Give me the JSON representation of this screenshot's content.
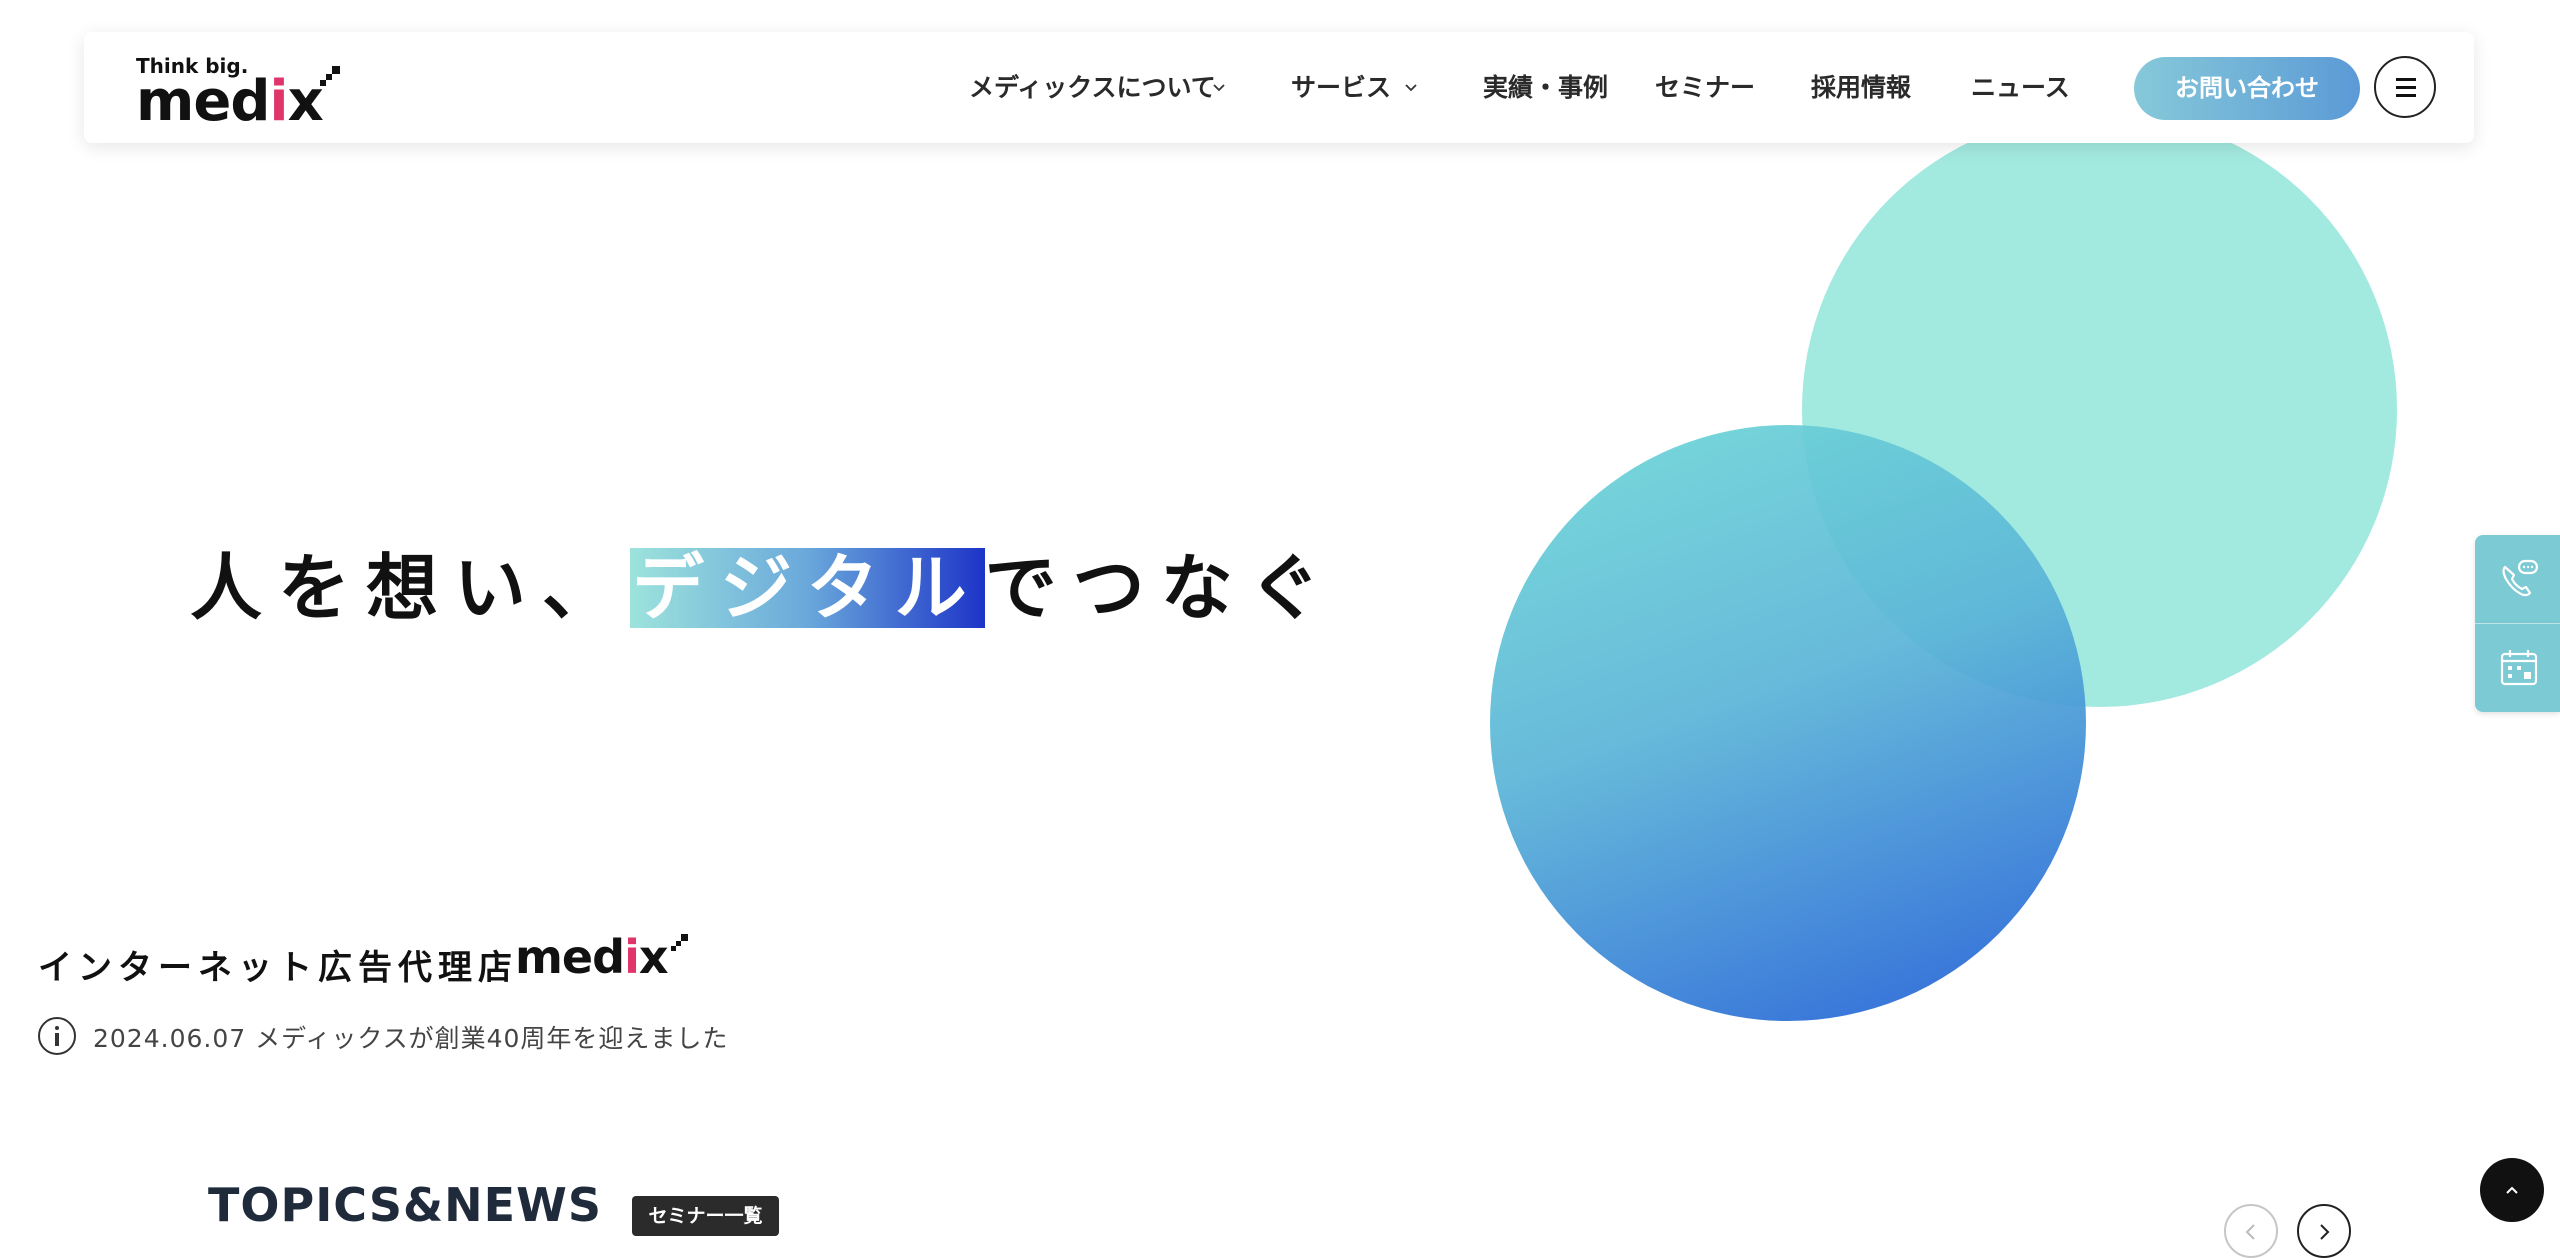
{
  "header": {
    "logo_tagline": "Think big.",
    "logo_name_start": "med",
    "logo_name_i": "i",
    "logo_name_end": "x",
    "nav": [
      {
        "label": "メディックスについて",
        "has_dropdown": true
      },
      {
        "label": "サービス",
        "has_dropdown": true
      },
      {
        "label": "実績・事例",
        "has_dropdown": false
      },
      {
        "label": "セミナー",
        "has_dropdown": false
      },
      {
        "label": "採用情報",
        "has_dropdown": false
      },
      {
        "label": "ニュース",
        "has_dropdown": false
      }
    ],
    "contact_label": "お問い合わせ",
    "menu_icon": "hamburger-icon"
  },
  "hero": {
    "headline_before": "人を想い、",
    "headline_highlight": "デジタル",
    "headline_after": "でつなぐ"
  },
  "agency": {
    "label": "インターネット広告代理店",
    "logo_name_start": "med",
    "logo_name_i": "i",
    "logo_name_end": "x"
  },
  "news": {
    "icon": "info-icon",
    "text": "2024.06.07 メディックスが創業40周年を迎えました"
  },
  "topics": {
    "title": "TOPICS&NEWS",
    "badge": "セミナー一覧",
    "prev_icon": "chevron-left-icon",
    "next_icon": "chevron-right-icon"
  },
  "side_tabs": [
    {
      "icon": "phone-chat-icon"
    },
    {
      "icon": "calendar-icon"
    }
  ],
  "back_to_top_icon": "chevron-up-icon",
  "colors": {
    "accent_pink": "#e0356b",
    "side_tab": "#7ccad4",
    "contact_gradient_start": "#86c9d9",
    "contact_gradient_end": "#5b9ad6",
    "circle_teal": "#76ded1",
    "circle_blue": "#235fd7"
  }
}
